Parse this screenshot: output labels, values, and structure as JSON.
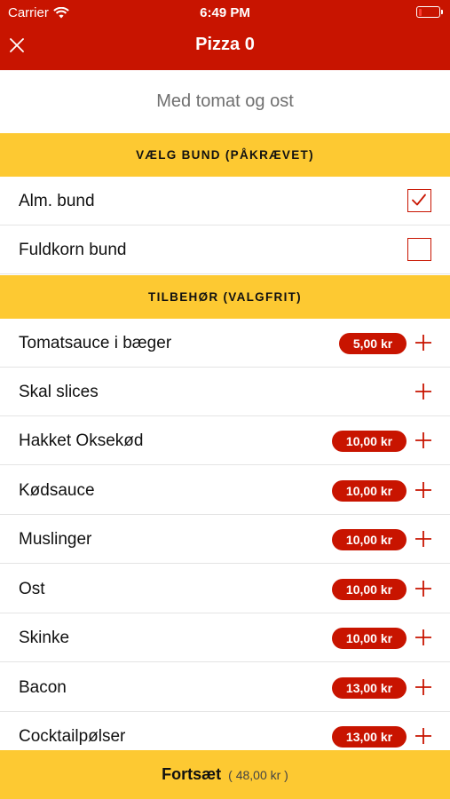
{
  "status_bar": {
    "carrier": "Carrier",
    "time": "6:49 PM",
    "battery_level": 0.18
  },
  "nav": {
    "title": "Pizza 0",
    "close_icon": "close-icon"
  },
  "description": "Med tomat og ost",
  "base_section": {
    "header": "VÆLG BUND (PÅKRÆVET)",
    "options": [
      {
        "label": "Alm. bund",
        "checked": true
      },
      {
        "label": "Fuldkorn bund",
        "checked": false
      }
    ]
  },
  "extras_section": {
    "header": "TILBEHØR (VALGFRIT)",
    "items": [
      {
        "label": "Tomatsauce i bæger",
        "price": "5,00 kr"
      },
      {
        "label": "Skal slices",
        "price": ""
      },
      {
        "label": "Hakket Oksekød",
        "price": "10,00 kr"
      },
      {
        "label": "Kødsauce",
        "price": "10,00 kr"
      },
      {
        "label": "Muslinger",
        "price": "10,00 kr"
      },
      {
        "label": "Ost",
        "price": "10,00 kr"
      },
      {
        "label": "Skinke",
        "price": "10,00 kr"
      },
      {
        "label": "Bacon",
        "price": "13,00 kr"
      },
      {
        "label": "Cocktailpølser",
        "price": "13,00 kr"
      }
    ]
  },
  "cta": {
    "label": "Fortsæt",
    "total": "( 48,00 kr )"
  },
  "colors": {
    "brand_red": "#c81400",
    "accent_yellow": "#fdc932"
  }
}
